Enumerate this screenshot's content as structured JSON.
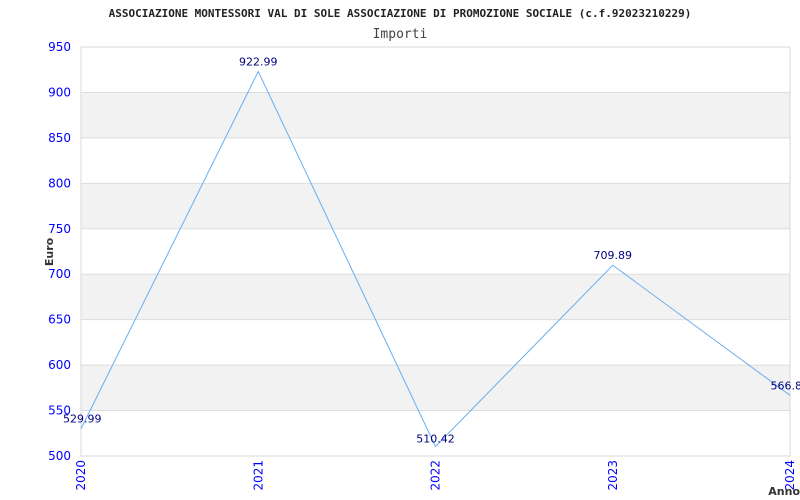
{
  "chart_data": {
    "type": "line",
    "title": "ASSOCIAZIONE MONTESSORI VAL DI SOLE ASSOCIAZIONE DI PROMOZIONE SOCIALE (c.f.92023210229)",
    "subtitle": "Importi",
    "xlabel": "Anno",
    "ylabel": "Euro",
    "categories": [
      "2020",
      "2021",
      "2022",
      "2023",
      "2024"
    ],
    "values": [
      529.99,
      922.99,
      510.42,
      709.89,
      566.8
    ],
    "data_labels": [
      "529.99",
      "922.99",
      "510.42",
      "709.89",
      "566.8"
    ],
    "ylim": [
      500,
      950
    ],
    "yticks": [
      500,
      550,
      600,
      650,
      700,
      750,
      800,
      850,
      900,
      950
    ],
    "grid": true,
    "banded_background": true,
    "colors": {
      "line": "#6aaef0",
      "band": "#f2f2f2",
      "tick_text": "#0000ff",
      "data_label": "#000080",
      "grid": "#dddddd"
    }
  }
}
